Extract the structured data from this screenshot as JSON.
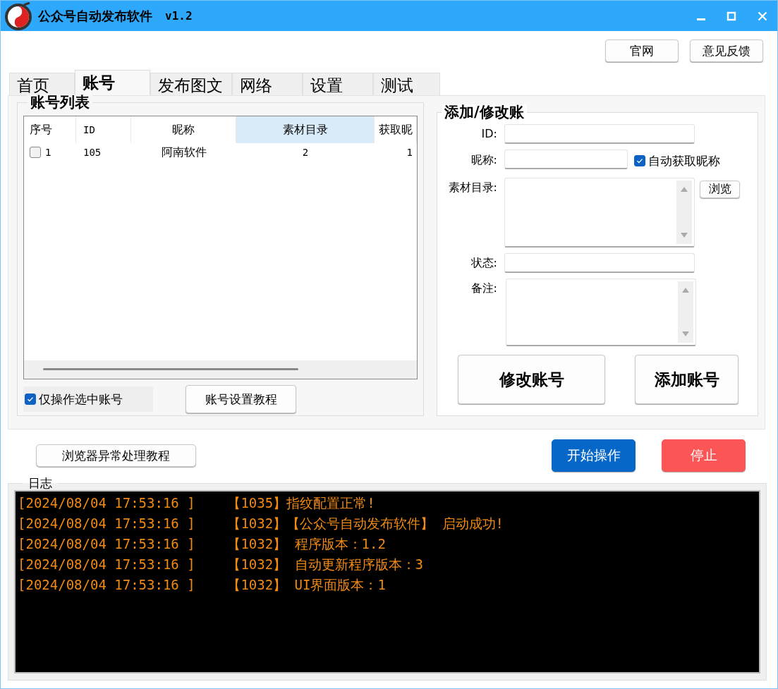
{
  "window": {
    "title": "公众号自动发布软件",
    "version": "v1.2"
  },
  "header_buttons": [
    "官网",
    "意见反馈"
  ],
  "tabs": [
    {
      "label": "首页",
      "selected": false
    },
    {
      "label": "账号",
      "selected": true
    },
    {
      "label": "发布图文",
      "selected": false
    },
    {
      "label": "网络",
      "selected": false
    },
    {
      "label": "设置",
      "selected": false
    },
    {
      "label": "测试",
      "selected": false
    }
  ],
  "account_list": {
    "title": "账号列表",
    "columns": [
      {
        "label": "序号",
        "selected": false
      },
      {
        "label": "ID",
        "selected": false
      },
      {
        "label": "昵称",
        "selected": false
      },
      {
        "label": "素材目录",
        "selected": true
      },
      {
        "label": "获取昵",
        "selected": false
      }
    ],
    "rows": [
      {
        "checked": false,
        "cells": [
          "1",
          "105",
          "阿南软件",
          "2",
          "1"
        ]
      }
    ],
    "only_selected": {
      "label": "仅操作选中账号",
      "checked": true
    },
    "tutorial_button": "账号设置教程"
  },
  "account_form": {
    "title": "添加/修改账",
    "fields": [
      {
        "kind": "input",
        "label": "ID:"
      },
      {
        "kind": "input_check",
        "label": "昵称:",
        "check": {
          "label": "自动获取昵称",
          "checked": true
        }
      },
      {
        "kind": "textarea_browse",
        "label": "素材目录:",
        "button": "浏览"
      },
      {
        "kind": "input",
        "label": "状态:"
      },
      {
        "kind": "textarea",
        "label": "备注:"
      }
    ],
    "buttons": [
      "修改账号",
      "添加账号"
    ]
  },
  "actions": [
    {
      "kind": "plain",
      "label": "浏览器异常处理教程"
    },
    {
      "kind": "primary",
      "label": "开始操作"
    },
    {
      "kind": "danger",
      "label": "停止"
    }
  ],
  "log": {
    "title": "日志",
    "lines": [
      "[2024/08/04 17:53:16 ]    【1035】指纹配置正常!",
      "[2024/08/04 17:53:16 ]    【1032】【公众号自动发布软件】 启动成功!",
      "[2024/08/04 17:53:16 ]    【1032】 程序版本：1.2",
      "[2024/08/04 17:53:16 ]    【1032】 自动更新程序版本：3",
      "[2024/08/04 17:53:16 ]    【1032】 UI界面版本：1"
    ]
  }
}
